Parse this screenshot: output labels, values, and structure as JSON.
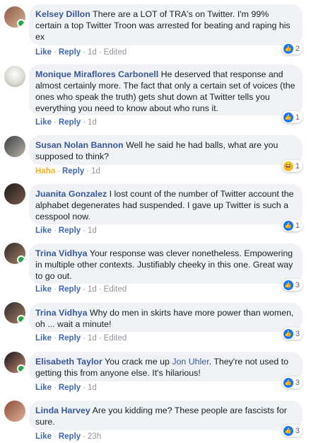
{
  "comments": [
    {
      "author": "Kelsey Dillon",
      "text": "There are a LOT of TRA's on Twitter. I'm 99% certain a top Twitter Troon was arrested for beating and raping his ex",
      "like": "Like",
      "reply": "Reply",
      "time": "1d",
      "edited": "Edited",
      "reaction_count": "2",
      "reaction_icon": "like-icon"
    },
    {
      "author": "Monique Miraflores Carbonell",
      "text": "He deserved that response and almost certainly more. The fact that only a certain set of voices (the ones who speak the truth) gets shut down at Twitter tells you everything you need to know about who runs it.",
      "like": "Like",
      "reply": "Reply",
      "time": "1d",
      "reaction_count": "1",
      "reaction_icon": "like-icon"
    },
    {
      "author": "Susan Nolan Bannon",
      "text": "Well he said he had balls, what are you supposed to think?",
      "like": "Haha",
      "reply": "Reply",
      "time": "1d",
      "reaction_count": "1",
      "reaction_icon": "haha-icon"
    },
    {
      "author": "Juanita Gonzalez",
      "text": "I lost count of the number of Twitter account the alphabet degenerates had suspended. I gave up Twitter is such a cesspool now.",
      "like": "Like",
      "reply": "Reply",
      "time": "1d",
      "reaction_count": "1",
      "reaction_icon": "like-icon"
    },
    {
      "author": "Trina Vidhya",
      "text": "Your response was clever nonetheless. Empowering in multiple other contexts. Justifiably cheeky in this one. Great way to go out.",
      "like": "Like",
      "reply": "Reply",
      "time": "1d",
      "edited": "Edited",
      "reaction_count": "3",
      "reaction_icon": "like-icon"
    },
    {
      "author": "Trina Vidhya",
      "text": "Why do men in skirts have more power than women, oh ... wait a minute!",
      "like": "Like",
      "reply": "Reply",
      "time": "1d",
      "edited": "Edited",
      "reaction_count": "3",
      "reaction_icon": "like-icon"
    },
    {
      "author": "Elisabeth Taylor",
      "text_before": "You crack me up",
      "mention": "Jon Uhler",
      "text_after": ". They're not used to getting this from anyone else. It's hilarious!",
      "like": "Like",
      "reply": "Reply",
      "time": "1d",
      "reaction_count": "3",
      "reaction_icon": "like-icon"
    },
    {
      "author": "Linda Harvey",
      "text": "Are you kidding me? These people are fascists for sure.",
      "like": "Like",
      "reply": "Reply",
      "time": "23h",
      "reaction_count": "3",
      "reaction_icon": "like-icon"
    }
  ]
}
